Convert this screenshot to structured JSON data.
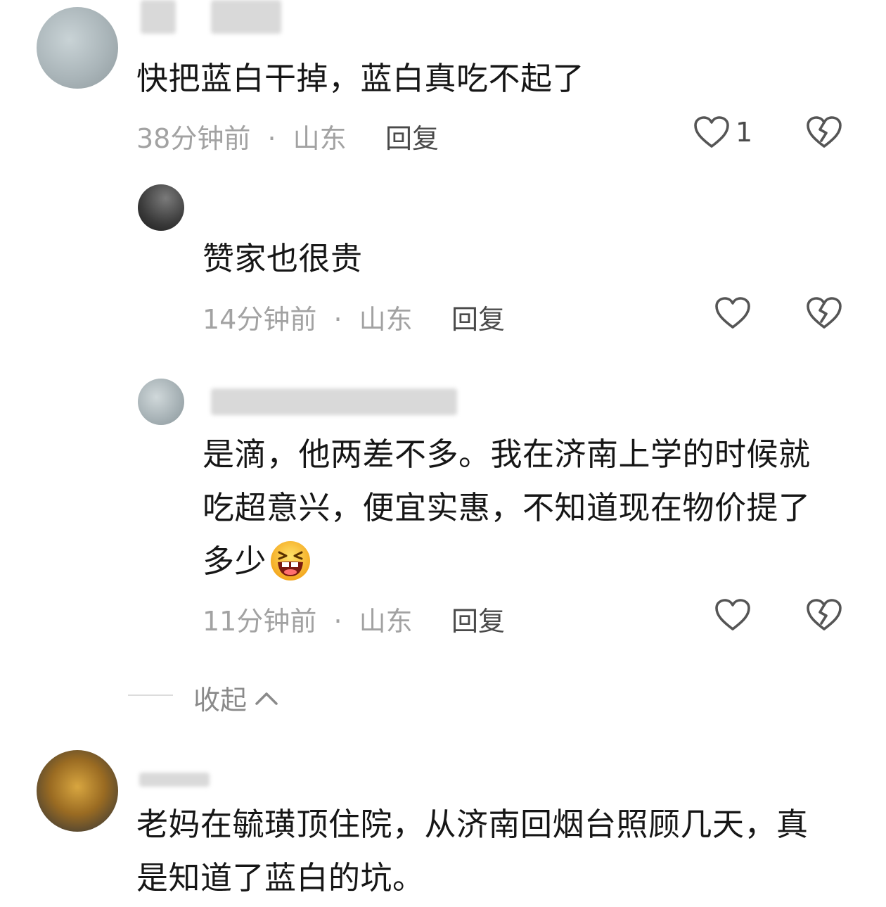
{
  "comments": [
    {
      "text": "快把蓝白干掉，蓝白真吃不起了",
      "time": "38分钟前",
      "location": "山东",
      "reply_label": "回复",
      "like_count": "1"
    },
    {
      "text": "赞家也很贵",
      "time": "14分钟前",
      "location": "山东",
      "reply_label": "回复"
    },
    {
      "line1": "是滴，他两差不多。我在济南上学的时候就",
      "line2": "吃超意兴，便宜实惠，不知道现在物价提了",
      "line3": "多少",
      "emoji_icon": "laughing-emoji-icon",
      "time": "11分钟前",
      "location": "山东",
      "reply_label": "回复"
    },
    {
      "line1": "老妈在毓璜顶住院，从济南回烟台照顾几天，真",
      "line2": "是知道了蓝白的坑。"
    }
  ],
  "separator": "·",
  "collapse_label": "收起",
  "icons": {
    "like": "heart-outline-icon",
    "dislike": "broken-heart-icon",
    "collapse": "chevron-up-icon"
  },
  "colors": {
    "text": "#161616",
    "meta": "#a2a2a2",
    "reply": "#4a4a4a",
    "icon": "#555555"
  }
}
